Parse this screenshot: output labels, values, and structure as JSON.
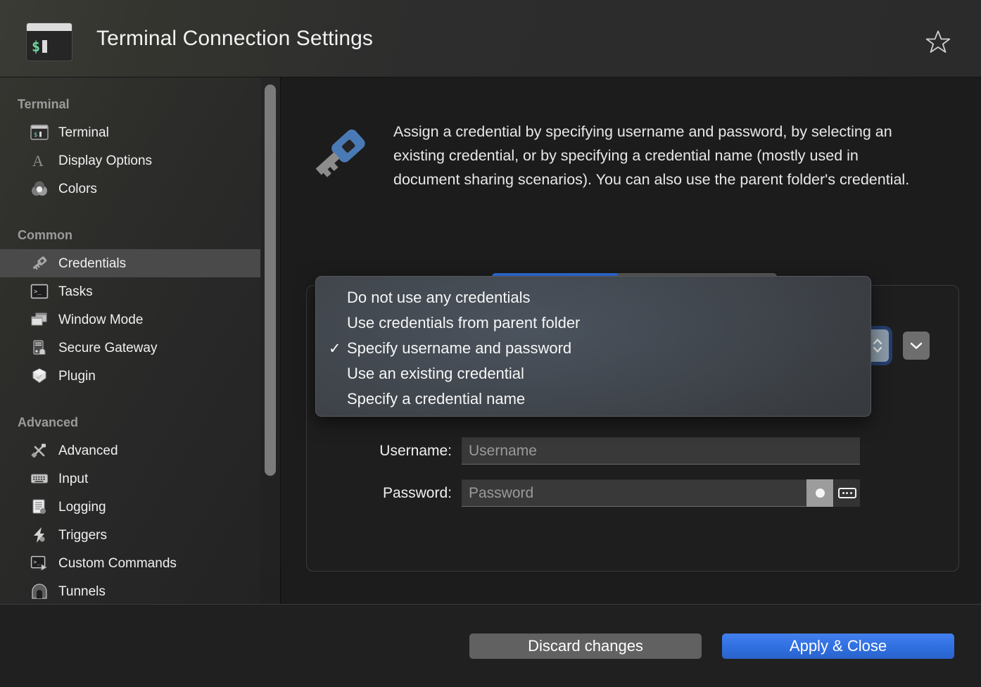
{
  "window": {
    "title": "Terminal Connection Settings",
    "app_icon": "terminal-icon",
    "icon_prompt": "$",
    "favorite_icon": "star-outline-icon"
  },
  "sidebar": {
    "groups": [
      {
        "title": "Terminal",
        "items": [
          {
            "label": "Terminal",
            "icon": "terminal-icon",
            "selected": false
          },
          {
            "label": "Display Options",
            "icon": "font-a-icon",
            "selected": false
          },
          {
            "label": "Colors",
            "icon": "color-circles-icon",
            "selected": false
          }
        ]
      },
      {
        "title": "Common",
        "items": [
          {
            "label": "Credentials",
            "icon": "key-icon",
            "selected": true
          },
          {
            "label": "Tasks",
            "icon": "console-icon",
            "selected": false
          },
          {
            "label": "Window Mode",
            "icon": "windows-icon",
            "selected": false
          },
          {
            "label": "Secure Gateway",
            "icon": "server-gateway-icon",
            "selected": false
          },
          {
            "label": "Plugin",
            "icon": "plugin-box-icon",
            "selected": false
          }
        ]
      },
      {
        "title": "Advanced",
        "items": [
          {
            "label": "Advanced",
            "icon": "tools-icon",
            "selected": false
          },
          {
            "label": "Input",
            "icon": "keyboard-icon",
            "selected": false
          },
          {
            "label": "Logging",
            "icon": "logbook-icon",
            "selected": false
          },
          {
            "label": "Triggers",
            "icon": "lightning-icon",
            "selected": false
          },
          {
            "label": "Custom Commands",
            "icon": "console-play-icon",
            "selected": false
          },
          {
            "label": "Tunnels",
            "icon": "tunnel-icon",
            "selected": false
          }
        ]
      }
    ]
  },
  "main": {
    "hero_icon": "key-icon",
    "description": "Assign a credential by specifying username and password, by selecting an existing credential, or by specifying a credential name (mostly used in document sharing scenarios). You can also use the parent folder's credential.",
    "fields": {
      "username_label": "Username:",
      "username_value": "",
      "username_placeholder": "Username",
      "password_label": "Password:",
      "password_value": "",
      "password_placeholder": "Password",
      "password_reveal_icon": "dot-icon",
      "password_keyboard_icon": "keypad-icon"
    },
    "stepper_icon": "chevron-up-down-icon",
    "dropdown_icon": "chevron-down-icon"
  },
  "popup": {
    "options": [
      {
        "label": "Do not use any credentials",
        "checked": false
      },
      {
        "label": "Use credentials from parent folder",
        "checked": false
      },
      {
        "label": "Specify username and password",
        "checked": true
      },
      {
        "label": "Use an existing credential",
        "checked": false
      },
      {
        "label": "Specify a credential name",
        "checked": false
      }
    ],
    "check_glyph": "✓"
  },
  "footer": {
    "discard_label": "Discard changes",
    "apply_label": "Apply & Close"
  },
  "colors": {
    "accent_blue": "#2f6fe0",
    "selected_row": "#4a4a4a",
    "key_head_blue": "#4a7ab5",
    "terminal_green": "#6fd6a0"
  }
}
